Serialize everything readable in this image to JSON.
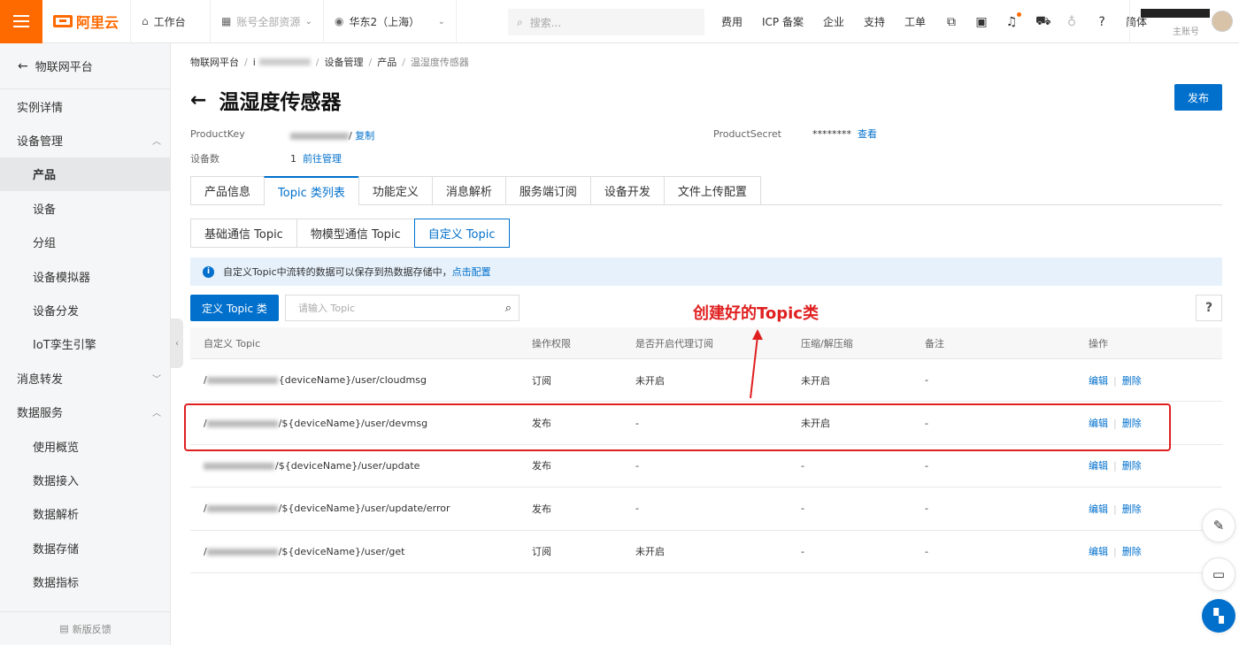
{
  "topbar": {
    "logo_text": "阿里云",
    "workbench": "工作台",
    "account_scope": "账号全部资源",
    "region": "华东2（上海）",
    "search_placeholder": "搜索...",
    "links": [
      "费用",
      "ICP 备案",
      "企业",
      "支持",
      "工单"
    ],
    "lang": "简体",
    "user_sub": "主账号"
  },
  "sidebar": {
    "back_label": "物联网平台",
    "items": [
      {
        "label": "实例详情",
        "level": 1
      },
      {
        "label": "设备管理",
        "level": 1,
        "expanded": true
      },
      {
        "label": "产品",
        "level": 2,
        "active": true
      },
      {
        "label": "设备",
        "level": 2
      },
      {
        "label": "分组",
        "level": 2
      },
      {
        "label": "设备模拟器",
        "level": 2
      },
      {
        "label": "设备分发",
        "level": 2
      },
      {
        "label": "IoT孪生引擎",
        "level": 2
      },
      {
        "label": "消息转发",
        "level": 1,
        "expanded": false
      },
      {
        "label": "数据服务",
        "level": 1,
        "expanded": true
      },
      {
        "label": "使用概览",
        "level": 2
      },
      {
        "label": "数据接入",
        "level": 2
      },
      {
        "label": "数据解析",
        "level": 2
      },
      {
        "label": "数据存储",
        "level": 2
      },
      {
        "label": "数据指标",
        "level": 2
      }
    ],
    "feedback": "新版反馈"
  },
  "breadcrumb": {
    "root": "物联网平台",
    "instance_prefix": "i",
    "device_mgmt": "设备管理",
    "product": "产品",
    "current": "温湿度传感器"
  },
  "page": {
    "title": "温湿度传感器",
    "publish_label": "发布",
    "product_key_label": "ProductKey",
    "product_key_suffix": "/",
    "copy_label": "复制",
    "device_count_label": "设备数",
    "device_count": "1",
    "manage_link": "前往管理",
    "product_secret_label": "ProductSecret",
    "product_secret_masked": "********",
    "view_label": "查看"
  },
  "tabs": [
    "产品信息",
    "Topic 类列表",
    "功能定义",
    "消息解析",
    "服务端订阅",
    "设备开发",
    "文件上传配置"
  ],
  "active_tab": 1,
  "subtabs": [
    "基础通信 Topic",
    "物模型通信 Topic",
    "自定义 Topic"
  ],
  "active_subtab": 2,
  "notice": {
    "text": "自定义Topic中流转的数据可以保存到热数据存储中，",
    "link": "点击配置"
  },
  "toolbar": {
    "create_label": "定义 Topic 类",
    "search_placeholder": "请输入 Topic",
    "help_label": "?"
  },
  "annotation": "创建好的Topic类",
  "colors": {
    "accent": "#0070cc",
    "brand": "#ff6a00",
    "annotation": "#e02020"
  },
  "table": {
    "headers": [
      "自定义 Topic",
      "操作权限",
      "是否开启代理订阅",
      "压缩/解压缩",
      "备注",
      "操作"
    ],
    "rows": [
      {
        "topic_prefix": "/",
        "topic": "{deviceName}/user/cloudmsg",
        "perm": "订阅",
        "proxy": "未开启",
        "compress": "未开启",
        "note": "-"
      },
      {
        "topic_prefix": "/",
        "topic": "/${deviceName}/user/devmsg",
        "perm": "发布",
        "proxy": "-",
        "compress": "未开启",
        "note": "-"
      },
      {
        "topic_prefix": "",
        "topic": "/${deviceName}/user/update",
        "perm": "发布",
        "proxy": "-",
        "compress": "-",
        "note": "-"
      },
      {
        "topic_prefix": "/",
        "topic": "/${deviceName}/user/update/error",
        "perm": "发布",
        "proxy": "-",
        "compress": "-",
        "note": "-"
      },
      {
        "topic_prefix": "/",
        "topic": "/${deviceName}/user/get",
        "perm": "订阅",
        "proxy": "未开启",
        "compress": "-",
        "note": "-"
      }
    ],
    "edit_label": "编辑",
    "delete_label": "删除"
  }
}
